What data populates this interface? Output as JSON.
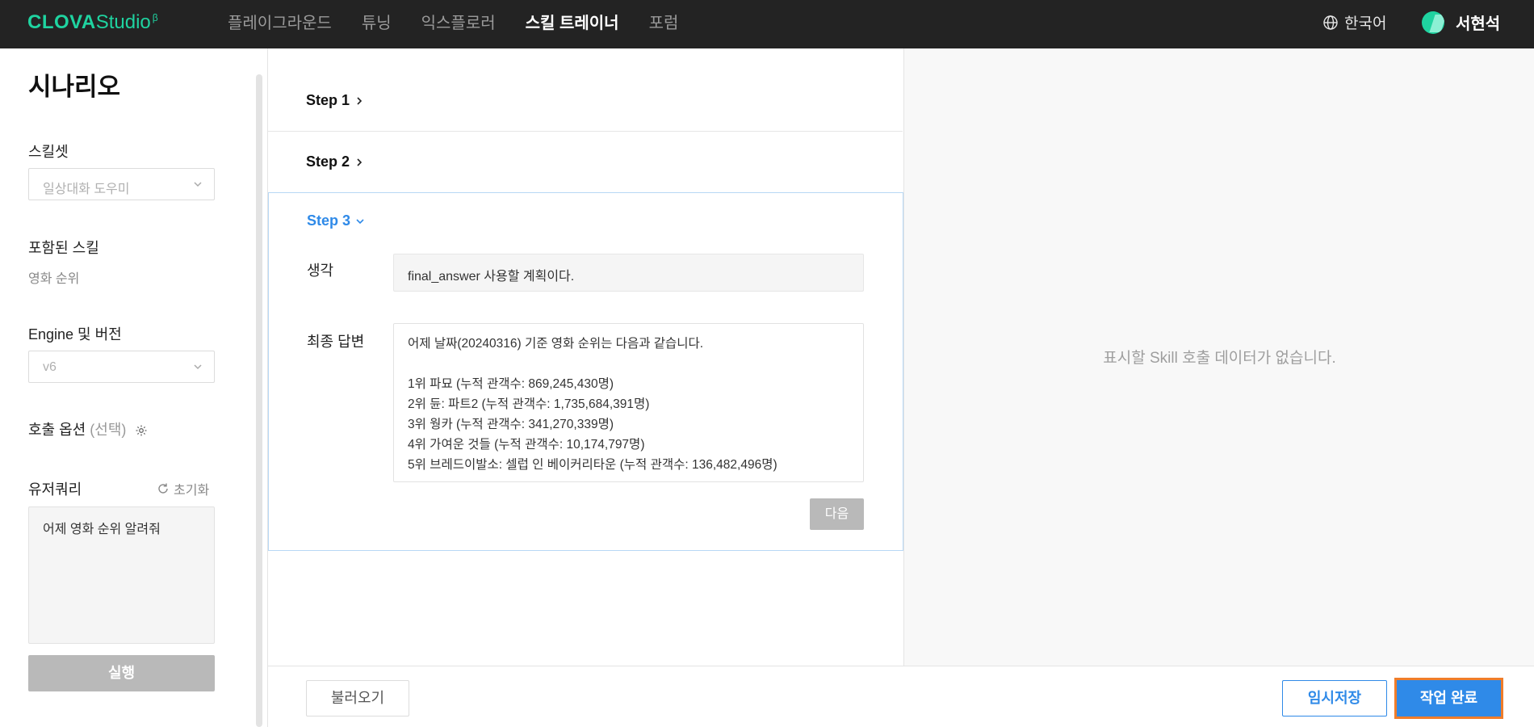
{
  "header": {
    "logo_main": "CLOVA",
    "logo_sub": "Studio",
    "logo_beta": "β",
    "nav": [
      {
        "label": "플레이그라운드",
        "active": false
      },
      {
        "label": "튜닝",
        "active": false
      },
      {
        "label": "익스플로러",
        "active": false
      },
      {
        "label": "스킬 트레이너",
        "active": true
      },
      {
        "label": "포럼",
        "active": false
      }
    ],
    "language": "한국어",
    "language_icon": "globe-icon",
    "user_name": "서현석"
  },
  "sidebar": {
    "title": "시나리오",
    "skillset_label": "스킬셋",
    "skillset_value": "일상대화 도우미",
    "included_label": "포함된 스킬",
    "included_value": "영화 순위",
    "engine_label": "Engine 및 버전",
    "engine_value": "v6",
    "call_option_label": "호출 옵션",
    "call_option_suffix": "(선택)",
    "user_query_label": "유저쿼리",
    "reset_label": "초기화",
    "user_query_value": "어제 영화 순위 알려줘",
    "run_label": "실행"
  },
  "steps": {
    "step1": "Step 1",
    "step2": "Step 2",
    "step3": "Step 3",
    "thought_label": "생각",
    "thought_value": "final_answer 사용할 계획이다.",
    "answer_label": "최종 답변",
    "answer_lines": [
      "어제 날짜(20240316) 기준 영화 순위는 다음과 같습니다.",
      "",
      "1위 파묘 (누적 관객수: 869,245,430명)",
      "2위 듄: 파트2 (누적 관객수: 1,735,684,391명)",
      "3위 웡카 (누적 관객수: 341,270,339명)",
      "4위 가여운 것들 (누적 관객수: 10,174,797명)",
      "5위 브레드이발소: 셀럽 인 베이커리타운 (누적 관객수: 136,482,496명)"
    ],
    "next_label": "다음"
  },
  "right_panel": {
    "empty_message": "표시할 Skill 호출 데이터가 없습니다."
  },
  "footer": {
    "load_label": "불러오기",
    "temp_save_label": "임시저장",
    "complete_label": "작업 완료"
  },
  "colors": {
    "brand": "#1fd3a0",
    "accent": "#2f8ae8",
    "highlight": "#f07d2a",
    "topbar": "#232323"
  }
}
